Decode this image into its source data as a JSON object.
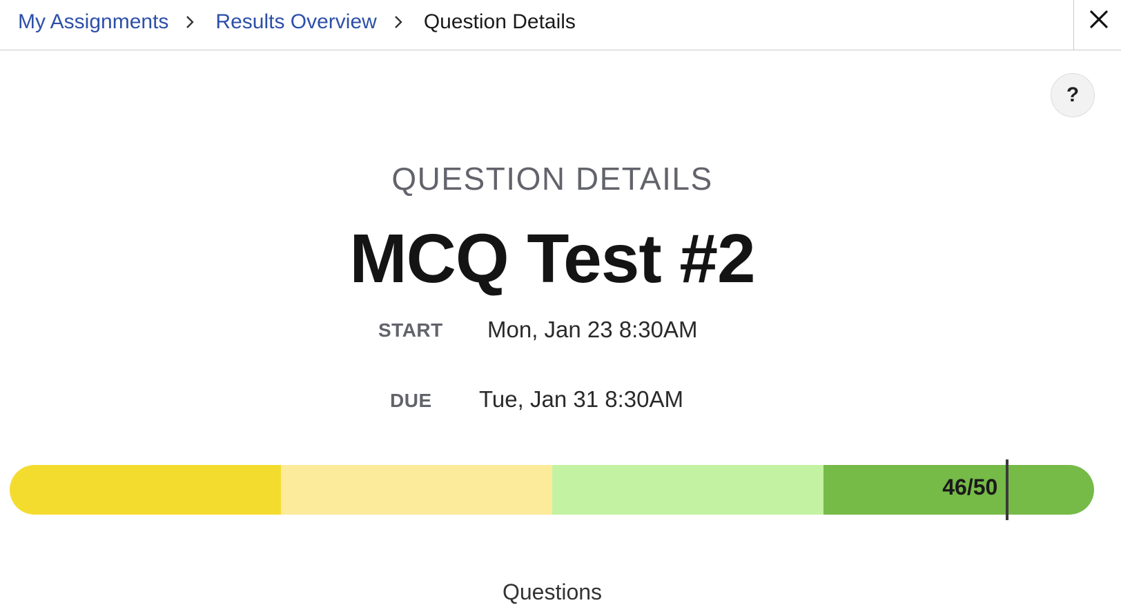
{
  "breadcrumb": {
    "items": [
      "My Assignments",
      "Results Overview"
    ],
    "current": "Question Details"
  },
  "header": {
    "subtitle": "QUESTION DETAILS",
    "title": "MCQ Test #2"
  },
  "schedule": {
    "start_label": "START",
    "start_value": "Mon, Jan 23 8:30AM",
    "due_label": "DUE",
    "due_value": "Tue, Jan 31 8:30AM"
  },
  "score": {
    "label": "46/50",
    "earned": 46,
    "total": 50,
    "band_colors": [
      "#f4dc2f",
      "#fbeb9a",
      "#c3f3a2",
      "#76ba48"
    ]
  },
  "questions": {
    "heading": "Questions"
  },
  "icons": {
    "close": "close-icon",
    "help": "help-icon",
    "separator": "chevron-right-icon"
  },
  "colors": {
    "link": "#2d4fa8",
    "muted": "#62636b"
  }
}
